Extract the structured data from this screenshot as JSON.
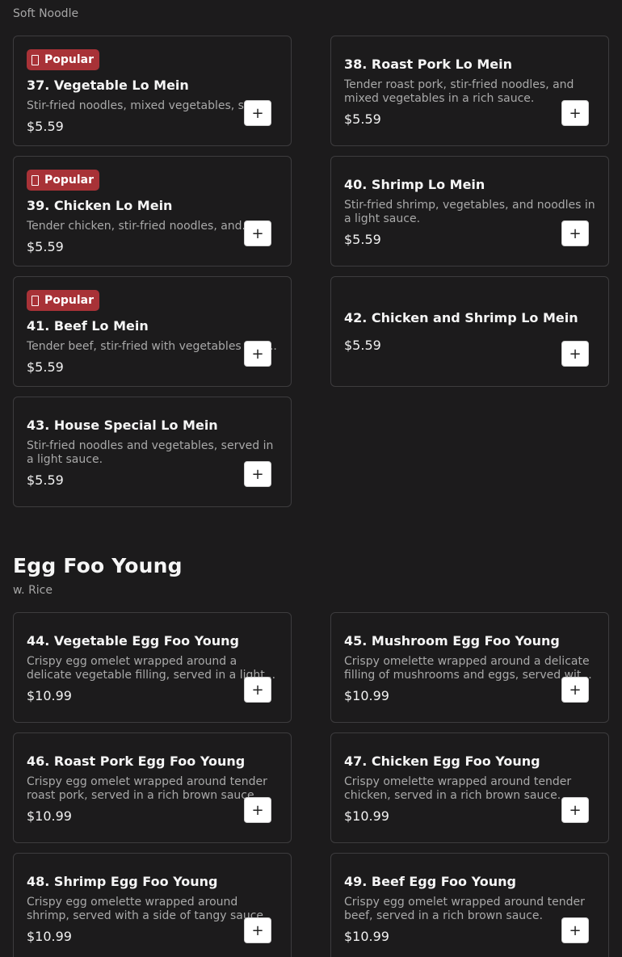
{
  "soft_noodle": {
    "subtitle": "Soft Noodle",
    "items": [
      {
        "title": "37. Vegetable Lo Mein",
        "desc": "Stir-fried noodles, mixed vegetables, soy sauce.",
        "price": "$5.59",
        "badge": "Popular"
      },
      {
        "title": "38. Roast Pork Lo Mein",
        "desc": "Tender roast pork, stir-fried noodles, and mixed vegetables in a rich sauce.",
        "price": "$5.59"
      },
      {
        "title": "39. Chicken Lo Mein",
        "desc": "Tender chicken, stir-fried noodles, and...",
        "price": "$5.59",
        "badge": "Popular"
      },
      {
        "title": "40. Shrimp Lo Mein",
        "desc": "Stir-fried shrimp, vegetables, and noodles in a light sauce.",
        "price": "$5.59"
      },
      {
        "title": "41. Beef Lo Mein",
        "desc": "Tender beef, stir-fried with vegetables and...",
        "price": "$5.59",
        "badge": "Popular"
      },
      {
        "title": "42. Chicken and Shrimp Lo Mein",
        "price": "$5.59"
      },
      {
        "title": "43. House Special Lo Mein",
        "desc": "Stir-fried noodles and vegetables, served in a light sauce.",
        "price": "$5.59"
      }
    ]
  },
  "egg_foo_young": {
    "heading": "Egg Foo Young",
    "subtitle": "w. Rice",
    "items": [
      {
        "title": "44. Vegetable Egg Foo Young",
        "desc": "Crispy egg omelet wrapped around a delicate vegetable filling, served in a light...",
        "price": "$10.99"
      },
      {
        "title": "45. Mushroom Egg Foo Young",
        "desc": "Crispy omelette wrapped around a delicate filling of mushrooms and eggs, served wit...",
        "price": "$10.99"
      },
      {
        "title": "46. Roast Pork Egg Foo Young",
        "desc": "Crispy egg omelet wrapped around tender roast pork, served in a rich brown sauce.",
        "price": "$10.99"
      },
      {
        "title": "47. Chicken Egg Foo Young",
        "desc": "Crispy omelette wrapped around tender chicken, served in a rich brown sauce.",
        "price": "$10.99"
      },
      {
        "title": "48. Shrimp Egg Foo Young",
        "desc": "Crispy egg omelette wrapped around shrimp, served with a side of tangy sauce.",
        "price": "$10.99"
      },
      {
        "title": "49. Beef Egg Foo Young",
        "desc": "Crispy egg omelet wrapped around tender beef, served in a rich brown sauce.",
        "price": "$10.99"
      }
    ]
  },
  "ui": {
    "add_label": "+",
    "icons": {
      "badge": "flame-icon",
      "add": "plus-icon"
    },
    "colors": {
      "background": "#1c1b1c",
      "badge": "#a83237",
      "card_border": "#3d3c3e"
    }
  }
}
